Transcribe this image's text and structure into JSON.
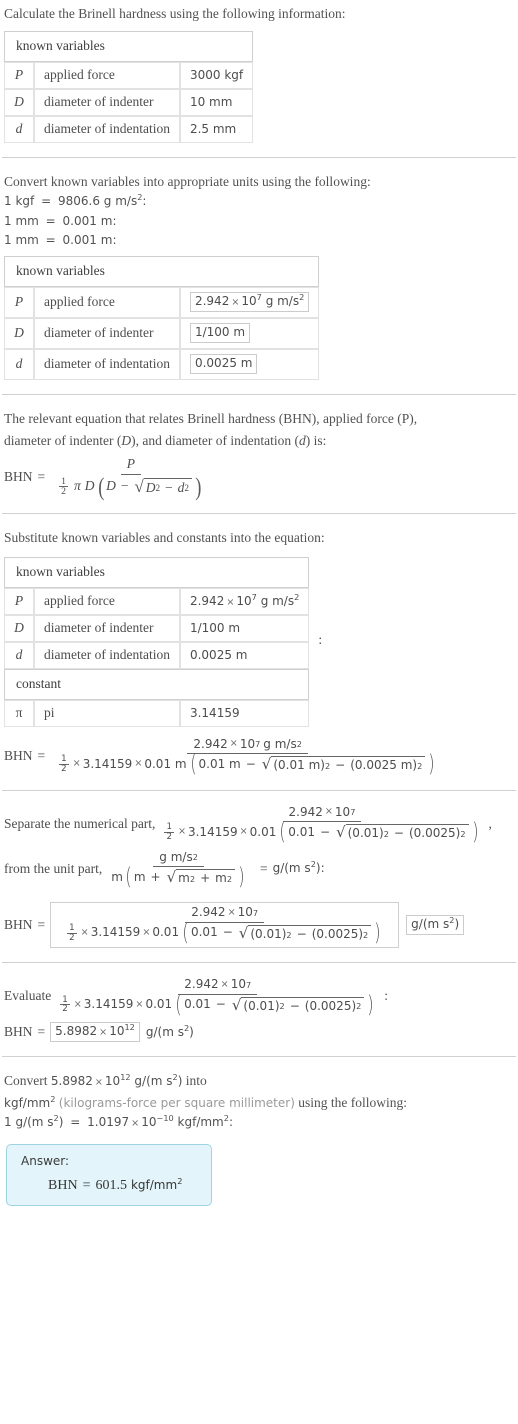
{
  "problem": {
    "intro": "Calculate the Brinell hardness using the following information:"
  },
  "table_given": {
    "header": "known variables",
    "rows": [
      {
        "symbol": "P",
        "name": "applied force",
        "value": "3000 kgf"
      },
      {
        "symbol": "D",
        "name": "diameter of indenter",
        "value": "10 mm"
      },
      {
        "symbol": "d",
        "name": "diameter of indentation",
        "value": "2.5 mm"
      }
    ]
  },
  "convert": {
    "intro": "Convert known variables into appropriate units using the following:",
    "rules": [
      {
        "lhs": "1 kgf",
        "rhs_num": "9806.6",
        "rhs_unit": "g m/s",
        "rhs_exp": "2",
        "tail": ":"
      },
      {
        "lhs": "1 mm",
        "rhs_num": "0.001",
        "rhs_unit": "m",
        "rhs_exp": "",
        "tail": ":"
      },
      {
        "lhs": "1 mm",
        "rhs_num": "0.001",
        "rhs_unit": "m",
        "rhs_exp": "",
        "tail": ":"
      }
    ]
  },
  "table_converted": {
    "header": "known variables",
    "rows": [
      {
        "symbol": "P",
        "name": "applied force",
        "mantissa": "2.942",
        "base": "10",
        "exp": "7",
        "unit": "g m/s",
        "unit_exp": "2",
        "boxed": true
      },
      {
        "symbol": "D",
        "name": "diameter of indenter",
        "value": "1/100 m",
        "boxed": true
      },
      {
        "symbol": "d",
        "name": "diameter of indentation",
        "value": "0.0025 m",
        "boxed": true
      }
    ]
  },
  "equation_section": {
    "line1": "The relevant equation that relates Brinell hardness (BHN), applied force (P),",
    "line2_a": "diameter of indenter (",
    "line2_D": "D",
    "line2_b": "), and diameter of indentation (",
    "line2_d": "d",
    "line2_c": ") is:",
    "lhs": "BHN",
    "equals": "=",
    "numerator": "P",
    "pi": "π",
    "D": "D",
    "minus": "−",
    "D_sq_exp": "2",
    "d_sq_exp": "2"
  },
  "substitute": {
    "intro": "Substitute known variables and constants into the equation:",
    "header_vars": "known variables",
    "header_const": "constant",
    "rows": [
      {
        "symbol": "P",
        "name": "applied force",
        "mantissa": "2.942",
        "base": "10",
        "exp": "7",
        "unit": "g m/s",
        "unit_exp": "2"
      },
      {
        "symbol": "D",
        "name": "diameter of indenter",
        "value": "1/100 m"
      },
      {
        "symbol": "d",
        "name": "diameter of indentation",
        "value": "0.0025 m"
      }
    ],
    "const_row": {
      "symbol": "π",
      "name": "pi",
      "value": "3.14159"
    },
    "colon": ":",
    "result": {
      "lhs": "BHN",
      "equals": "=",
      "num_mantissa": "2.942",
      "num_base": "10",
      "num_exp": "7",
      "num_unit": "g m/s",
      "num_unit_exp": "2",
      "den_pi": "3.14159",
      "den_D": "0.01 m",
      "den_inner_first": "0.01 m",
      "den_minus": "−",
      "den_sq1": "(0.01 m)",
      "den_sq1_exp": "2",
      "den_sq2": "(0.0025 m)",
      "den_sq2_exp": "2",
      "den_minus2": "−"
    }
  },
  "separate": {
    "label_numeric": "Separate the numerical part,",
    "numeric": {
      "num_mantissa": "2.942",
      "num_base": "10",
      "num_exp": "7",
      "den_pi": "3.14159",
      "den_D": "0.01",
      "den_inner_first": "0.01",
      "den_minus": "−",
      "den_sq1": "(0.01)",
      "den_sq1_exp": "2",
      "den_sq2": "(0.0025)",
      "den_sq2_exp": "2"
    },
    "comma": ",",
    "label_unit": "from the unit part,",
    "unit": {
      "num": "g m/s",
      "num_exp": "2",
      "den_m1": "m",
      "den_m2": "m",
      "den_plus": "+",
      "den_r1": "m",
      "den_r1_exp": "2",
      "den_r_plus": "+",
      "den_r2": "m",
      "den_r2_exp": "2"
    },
    "equals": "=",
    "unit_result": "g/(m s",
    "unit_result_exp": "2",
    "unit_result_tail": "):",
    "boxed_line": {
      "lhs": "BHN",
      "equals": "=",
      "unit_label": "g/(m s",
      "unit_label_exp": "2",
      "unit_label_tail": ")"
    }
  },
  "evaluate": {
    "label": "Evaluate",
    "colon": ":",
    "num_mantissa": "2.942",
    "num_base": "10",
    "num_exp": "7",
    "den_pi": "3.14159",
    "den_D": "0.01",
    "den_inner_first": "0.01",
    "den_minus": "−",
    "den_sq1": "(0.01)",
    "den_sq1_exp": "2",
    "den_sq2": "(0.0025)",
    "den_sq2_exp": "2",
    "result": {
      "lhs": "BHN",
      "equals": "=",
      "mantissa": "5.8982",
      "base": "10",
      "exp": "12",
      "unit": "g/(m s",
      "unit_exp": "2",
      "unit_tail": ")"
    }
  },
  "final_convert": {
    "line1_a": "Convert",
    "line1_mantissa": "5.8982",
    "line1_base": "10",
    "line1_exp": "12",
    "line1_unit": "g/(m s",
    "line1_unit_exp": "2",
    "line1_unit_tail": ")",
    "line1_b": "into",
    "line2_unit": "kgf/mm",
    "line2_unit_exp": "2",
    "line2_paren": "(kilograms-force per square millimeter)",
    "line2_tail": "using the following:",
    "line3_lhs": "1 g/(m s",
    "line3_lhs_exp": "2",
    "line3_lhs_tail": ")",
    "line3_eq": "=",
    "line3_mantissa": "1.0197",
    "line3_base": "10",
    "line3_exp": "−10",
    "line3_unit": "kgf/mm",
    "line3_unit_exp": "2",
    "line3_colon": ":"
  },
  "answer": {
    "label": "Answer:",
    "lhs": "BHN",
    "equals": "=",
    "value": "601.5",
    "unit": "kgf/mm",
    "unit_exp": "2"
  },
  "colors": {
    "text": "#4d4d4d",
    "border": "#e2e2e2",
    "divider": "#d0d0d0",
    "answer_bg": "#e3f5fa",
    "answer_border": "#9fd4e0",
    "box_border": "#cccccc"
  }
}
